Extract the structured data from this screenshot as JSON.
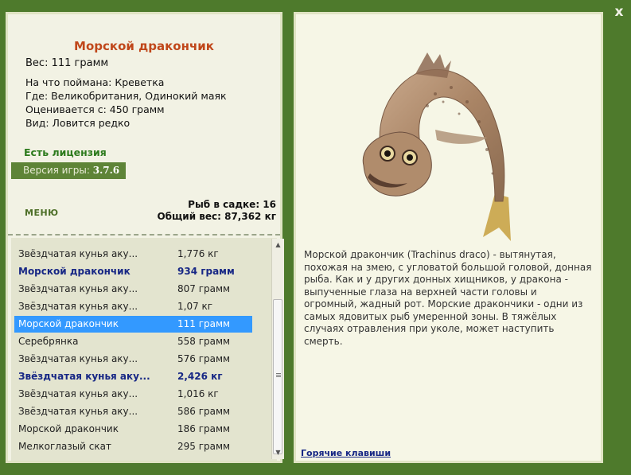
{
  "fish": {
    "title": "Морской дракончик",
    "weight_line": "Вес: 111 грамм",
    "info": [
      "На что поймана: Креветка",
      "Где: Великобритания, Одинокий маяк",
      "Оценивается с: 450 грамм",
      "Вид: Ловится редко"
    ]
  },
  "license_text": "Есть лицензия",
  "version": {
    "label": "Версия игры:",
    "value": "3.7.6"
  },
  "menu_label": "МЕНЮ",
  "stats": {
    "fish_count": "Рыб в садке: 16",
    "total_weight": "Общий вес: 87,362 кг"
  },
  "catch_list": [
    {
      "name": "Звёздчатая кунья аку...",
      "weight": "1,776 кг",
      "style": "normal"
    },
    {
      "name": "Морской дракончик",
      "weight": "934 грамм",
      "style": "bold"
    },
    {
      "name": "Звёздчатая кунья аку...",
      "weight": "807 грамм",
      "style": "normal"
    },
    {
      "name": "Звёздчатая кунья аку...",
      "weight": "1,07 кг",
      "style": "normal"
    },
    {
      "name": "Морской дракончик",
      "weight": "111 грамм",
      "style": "selected"
    },
    {
      "name": "Серебрянка",
      "weight": "558 грамм",
      "style": "normal"
    },
    {
      "name": "Звёздчатая кунья аку...",
      "weight": "576 грамм",
      "style": "normal"
    },
    {
      "name": "Звёздчатая кунья аку...",
      "weight": "2,426 кг",
      "style": "bold"
    },
    {
      "name": "Звёздчатая кунья аку...",
      "weight": "1,016 кг",
      "style": "normal"
    },
    {
      "name": "Звёздчатая кунья аку...",
      "weight": "586 грамм",
      "style": "normal"
    },
    {
      "name": "Морской дракончик",
      "weight": "186 грамм",
      "style": "normal"
    },
    {
      "name": "Мелкоглазый скат",
      "weight": "295 грамм",
      "style": "normal"
    }
  ],
  "description": "Морской дракончик (Trachinus draco) - вытянутая, похожая на змею, с угловатой большой головой, донная рыба. Как и у других донных хищников, у дракона - выпученные глаза на верхней части головы и огромный, жадный рот. Морские дракончики - одни из самых ядовитых рыб умеренной зоны. В тяжёлых случаях отравления при уколе, может наступить смерть.",
  "hotkeys_label": "Горячие клавиши",
  "close_glyph": "x",
  "colors": {
    "background": "#4e7a2c",
    "title": "#c0471a",
    "license": "#2c7a1c",
    "selected_row": "#3399ff",
    "bold_row": "#172785"
  },
  "icons": [
    "close-icon",
    "scroll-up-icon",
    "scroll-down-icon",
    "fish-image"
  ]
}
